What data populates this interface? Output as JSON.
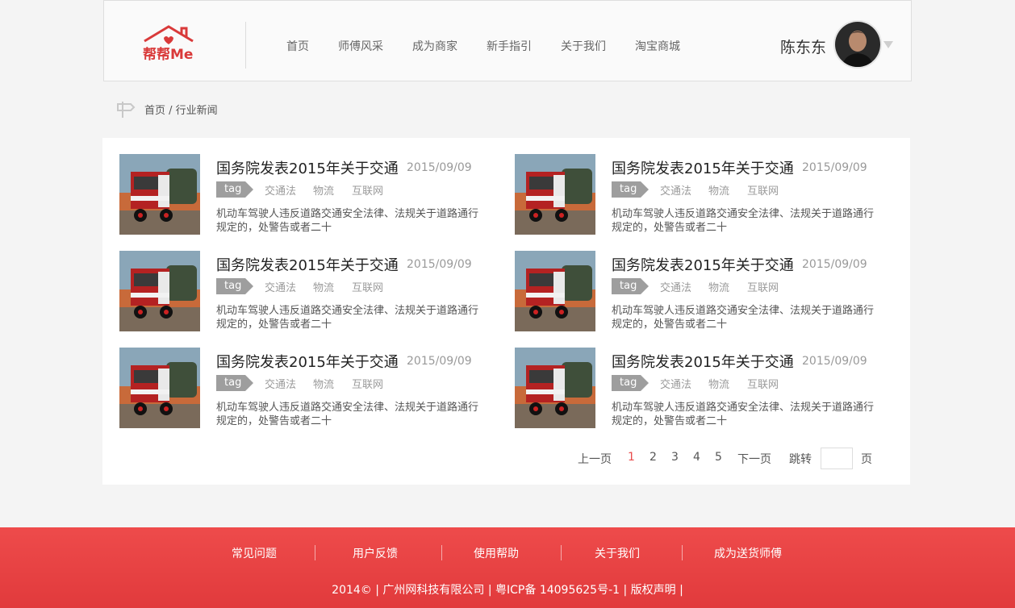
{
  "header": {
    "logo_alt": "帮帮Me",
    "nav": [
      "首页",
      "师傅风采",
      "成为商家",
      "新手指引",
      "关于我们",
      "淘宝商城"
    ],
    "user_name": "陈东东"
  },
  "breadcrumb": {
    "home": "首页",
    "separator": " / ",
    "current": "行业新闻"
  },
  "articles": [
    {
      "title": "国务院发表2015年关于交通",
      "date": "2015/09/09",
      "tag_label": "tag",
      "tags": [
        "交通法",
        "物流",
        "互联网"
      ],
      "summary": "机动车驾驶人违反道路交通安全法律、法规关于道路通行规定的，处警告或者二十"
    },
    {
      "title": "国务院发表2015年关于交通",
      "date": "2015/09/09",
      "tag_label": "tag",
      "tags": [
        "交通法",
        "物流",
        "互联网"
      ],
      "summary": "机动车驾驶人违反道路交通安全法律、法规关于道路通行规定的，处警告或者二十"
    },
    {
      "title": "国务院发表2015年关于交通",
      "date": "2015/09/09",
      "tag_label": "tag",
      "tags": [
        "交通法",
        "物流",
        "互联网"
      ],
      "summary": "机动车驾驶人违反道路交通安全法律、法规关于道路通行规定的，处警告或者二十"
    },
    {
      "title": "国务院发表2015年关于交通",
      "date": "2015/09/09",
      "tag_label": "tag",
      "tags": [
        "交通法",
        "物流",
        "互联网"
      ],
      "summary": "机动车驾驶人违反道路交通安全法律、法规关于道路通行规定的，处警告或者二十"
    },
    {
      "title": "国务院发表2015年关于交通",
      "date": "2015/09/09",
      "tag_label": "tag",
      "tags": [
        "交通法",
        "物流",
        "互联网"
      ],
      "summary": "机动车驾驶人违反道路交通安全法律、法规关于道路通行规定的，处警告或者二十"
    },
    {
      "title": "国务院发表2015年关于交通",
      "date": "2015/09/09",
      "tag_label": "tag",
      "tags": [
        "交通法",
        "物流",
        "互联网"
      ],
      "summary": "机动车驾驶人违反道路交通安全法律、法规关于道路通行规定的，处警告或者二十"
    }
  ],
  "pagination": {
    "prev": "上一页",
    "pages": [
      "1",
      "2",
      "3",
      "4",
      "5"
    ],
    "current_page": "1",
    "next": "下一页",
    "jump_label": "跳转",
    "jump_value": "",
    "page_suffix": "页"
  },
  "footer": {
    "links": [
      "常见问题",
      "用户反馈",
      "使用帮助",
      "关于我们",
      "成为送货师傅"
    ],
    "copyright": "2014©  |  广州网科技有限公司  |  粤ICP备 14095625号-1  |  版权声明  |"
  },
  "colors": {
    "accent": "#e94b4b",
    "footer_bg": "#e8423f",
    "tag_bg": "#9e9e9e"
  }
}
